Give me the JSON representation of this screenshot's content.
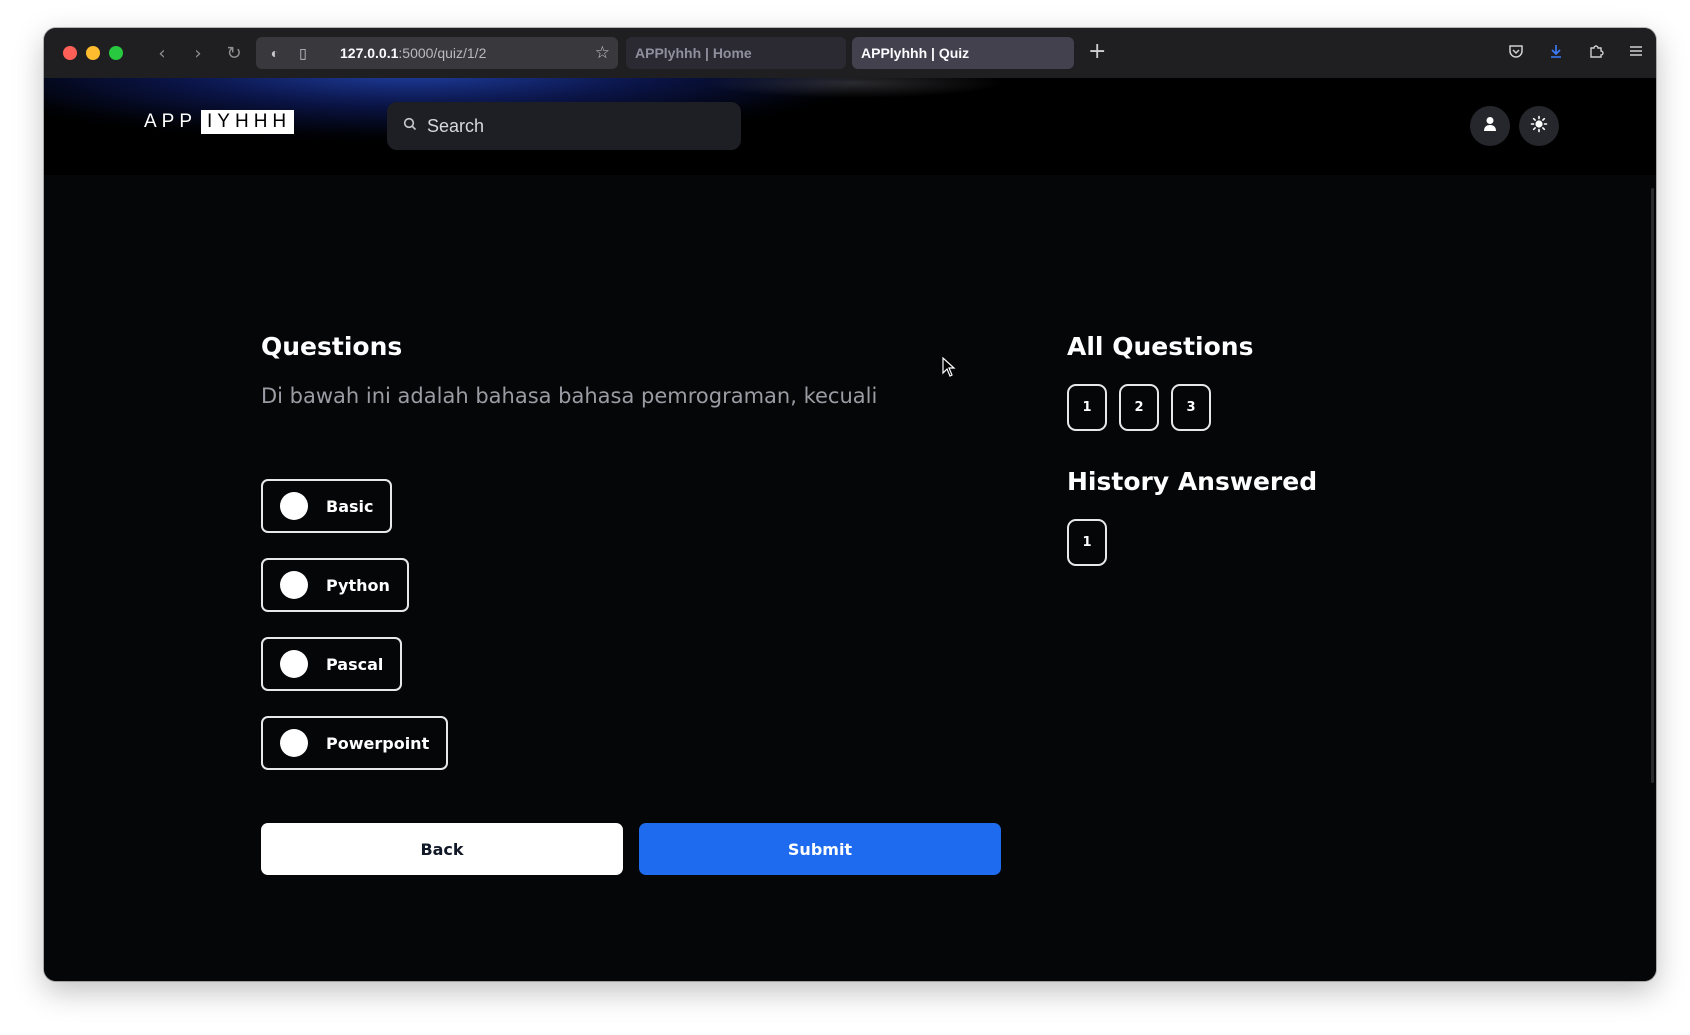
{
  "browser": {
    "url_host": "127.0.0.1",
    "url_path": ":5000/quiz/1/2",
    "tabs": [
      {
        "title": "APPlyhhh | Home",
        "active": false
      },
      {
        "title": "APPlyhhh | Quiz",
        "active": true
      }
    ],
    "icons": [
      "back-icon",
      "forward-icon",
      "reload-icon",
      "shield-icon",
      "page-icon",
      "star-icon",
      "plus-icon",
      "pocket-icon",
      "download-icon",
      "extensions-icon",
      "menu-icon"
    ]
  },
  "header": {
    "logo_left": "APP",
    "logo_right": "IYHHH",
    "search_placeholder": "Search"
  },
  "quiz": {
    "title": "Questions",
    "question": "Di bawah ini adalah bahasa bahasa pemrograman, kecuali",
    "options": [
      "Basic",
      "Python",
      "Pascal",
      "Powerpoint"
    ],
    "back_label": "Back",
    "submit_label": "Submit"
  },
  "sidebar": {
    "all_title": "All Questions",
    "all_numbers": [
      "1",
      "2",
      "3"
    ],
    "history_title": "History Answered",
    "history_numbers": [
      "1"
    ]
  },
  "colors": {
    "background": "#050608",
    "submit": "#1e6bf0",
    "back": "#ffffff",
    "muted_text": "#9a9ca3"
  }
}
